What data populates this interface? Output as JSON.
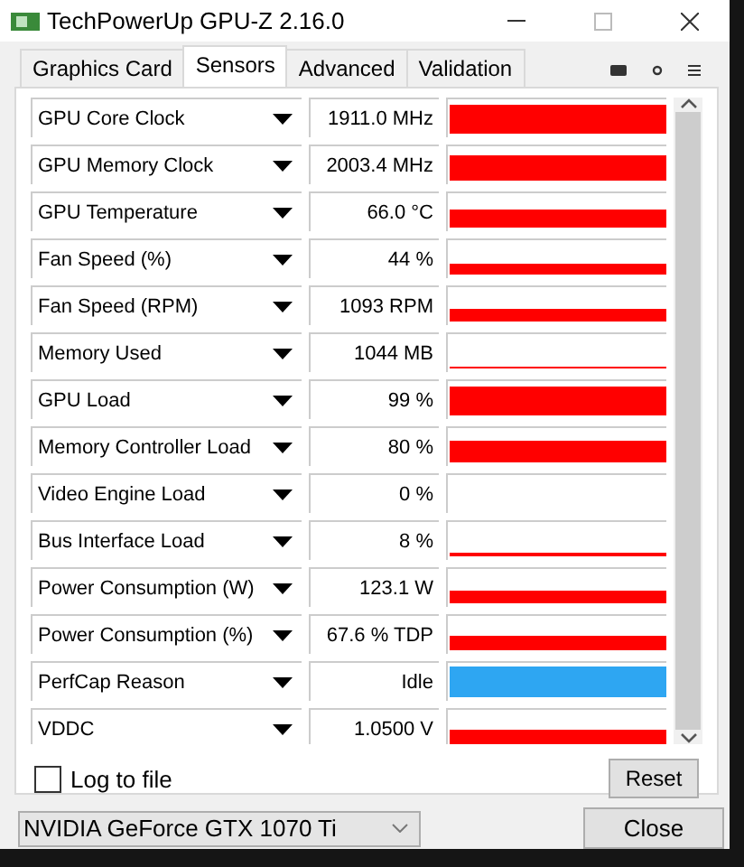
{
  "window": {
    "title": "TechPowerUp GPU-Z 2.16.0"
  },
  "tabs": [
    {
      "label": "Graphics Card",
      "selected": false
    },
    {
      "label": "Sensors",
      "selected": true
    },
    {
      "label": "Advanced",
      "selected": false
    },
    {
      "label": "Validation",
      "selected": false
    }
  ],
  "sensors": [
    {
      "name": "GPU Core Clock",
      "reading": "1911.0 MHz",
      "color": "#ff0000"
    },
    {
      "name": "GPU Memory Clock",
      "reading": "2003.4 MHz",
      "color": "#ff0000"
    },
    {
      "name": "GPU Temperature",
      "reading": "66.0 °C",
      "color": "#ff0000"
    },
    {
      "name": "Fan Speed (%)",
      "reading": "44 %",
      "color": "#ff0000"
    },
    {
      "name": "Fan Speed (RPM)",
      "reading": "1093 RPM",
      "color": "#ff0000"
    },
    {
      "name": "Memory Used",
      "reading": "1044 MB",
      "color": "#ff0000"
    },
    {
      "name": "GPU Load",
      "reading": "99 %",
      "color": "#ff0000"
    },
    {
      "name": "Memory Controller Load",
      "reading": "80 %",
      "color": "#ff0000"
    },
    {
      "name": "Video Engine Load",
      "reading": "0 %"
    },
    {
      "name": "Bus Interface Load",
      "reading": "8 %",
      "color": "#ff0000"
    },
    {
      "name": "Power Consumption (W)",
      "reading": "123.1 W",
      "color": "#ff0000"
    },
    {
      "name": "Power Consumption (%)",
      "reading": "67.6 % TDP",
      "color": "#ff0000"
    },
    {
      "name": "PerfCap Reason",
      "reading": "Idle",
      "color": "#2ea6f2"
    },
    {
      "name": "VDDC",
      "reading": "1.0500 V",
      "color": "#ff0000"
    }
  ],
  "log_to_file": {
    "label": "Log to file",
    "checked": false
  },
  "reset_button": "Reset",
  "device_select": {
    "value": "NVIDIA GeForce GTX 1070 Ti"
  },
  "close_button": "Close"
}
